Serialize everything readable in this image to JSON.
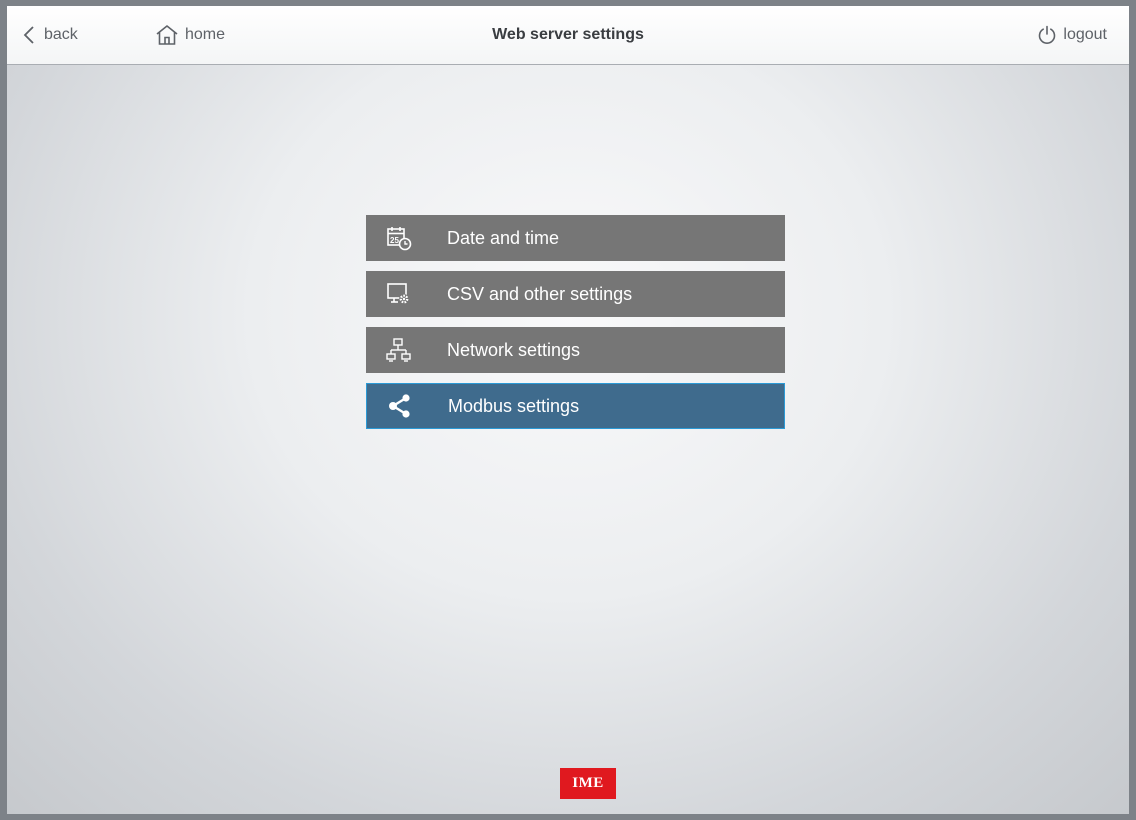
{
  "header": {
    "back_label": "back",
    "home_label": "home",
    "title": "Web server settings",
    "logout_label": "logout"
  },
  "menu": {
    "items": [
      {
        "label": "Date and time",
        "icon": "calendar-clock-icon",
        "active": false
      },
      {
        "label": "CSV and other settings",
        "icon": "monitor-gear-icon",
        "active": false
      },
      {
        "label": "Network settings",
        "icon": "network-icon",
        "active": false
      },
      {
        "label": "Modbus settings",
        "icon": "share-icon",
        "active": true
      }
    ]
  },
  "footer": {
    "logo_text": "IME"
  },
  "colors": {
    "menu_item": "#767676",
    "menu_item_active": "#3f6b8d",
    "menu_item_active_border": "#2b9ad6",
    "logo_red": "#e0191f"
  }
}
